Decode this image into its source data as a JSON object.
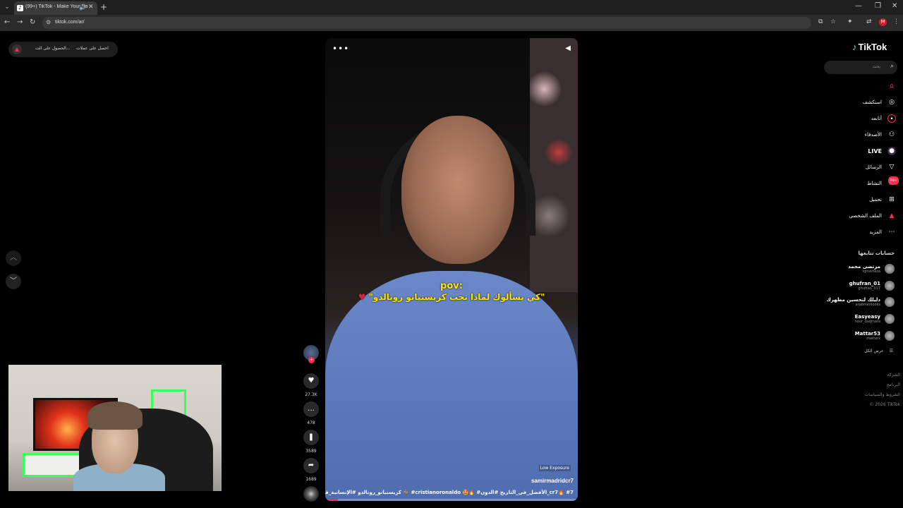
{
  "browser": {
    "tab_title": "(99+) TikTok - Make Your Day",
    "url": "tiktok.com/ar/",
    "profile_initial": "M",
    "icons": {
      "tab_menu": "chevron-down-icon",
      "audio": "speaker-icon",
      "close": "close-icon",
      "new_tab": "plus-icon",
      "back": "arrow-left-icon",
      "forward": "arrow-right-icon",
      "reload": "reload-icon",
      "site_info": "tune-icon",
      "install": "install-icon",
      "bookmark": "star-icon",
      "extensions": "puzzle-icon",
      "menu": "kebab-icon"
    }
  },
  "topbar": {
    "get_coins": "احصل على عملات",
    "get_app": "الحصول على الت..."
  },
  "sidebar": {
    "logo": "TikTok",
    "search_placeholder": "بحث",
    "nav": [
      {
        "label": "",
        "icon": "home-icon",
        "active": true
      },
      {
        "label": "استكشف",
        "icon": "compass-icon"
      },
      {
        "label": "أتابعه",
        "icon": "following-avatar-icon"
      },
      {
        "label": "الأصدقاء",
        "icon": "friends-icon"
      },
      {
        "label": "LIVE",
        "icon": "live-icon"
      },
      {
        "label": "الرسائل",
        "icon": "send-icon"
      },
      {
        "label": "النشاط",
        "icon": "inbox-icon",
        "badge": "99+"
      },
      {
        "label": "تحميل",
        "icon": "upload-icon"
      },
      {
        "label": "الملف الشخصي",
        "icon": "profile-avatar-icon"
      },
      {
        "label": "المزيد",
        "icon": "more-icon"
      }
    ],
    "following_title": "حسابات تتابعها",
    "following": [
      {
        "name": "مرتضى محمد",
        "handle": "iqmorteza"
      },
      {
        "name": "ghufran_01",
        "handle": "ghufran_017"
      },
      {
        "name": "دليلك لتحسين مظهرك",
        "handle": "arabmenlooks"
      },
      {
        "name": "Easyeasy",
        "handle": "nour_qaqmara"
      },
      {
        "name": "Mattar53",
        "handle": "mattarx"
      }
    ],
    "see_all": "عرض الكل",
    "footer": [
      "الشركة",
      "البرنامج",
      "الشروط والسياسات",
      "© 2026 TikTok"
    ]
  },
  "video": {
    "overlay_pov": "pov:",
    "overlay_main": "\"كي يسألوك لماذا تحب كريستيانو رونالدو\"",
    "low_exposure": "Low Exposure",
    "author": "samirmadridcr7",
    "description": "#كريستيانو_رونالدو #الإنسانية_قبل_الكورة 🐐 #cristianoronaldo 🤩🔥 #الأفضل_في_التاريخ #الدون_cr7🔥 #7",
    "progress": 0.05
  },
  "actions": {
    "likes": "27.3K",
    "comments": "478",
    "saves": "3589",
    "shares": "1689"
  },
  "colors": {
    "accent": "#fe2c55",
    "caption": "#ffe600",
    "background": "#000000"
  }
}
